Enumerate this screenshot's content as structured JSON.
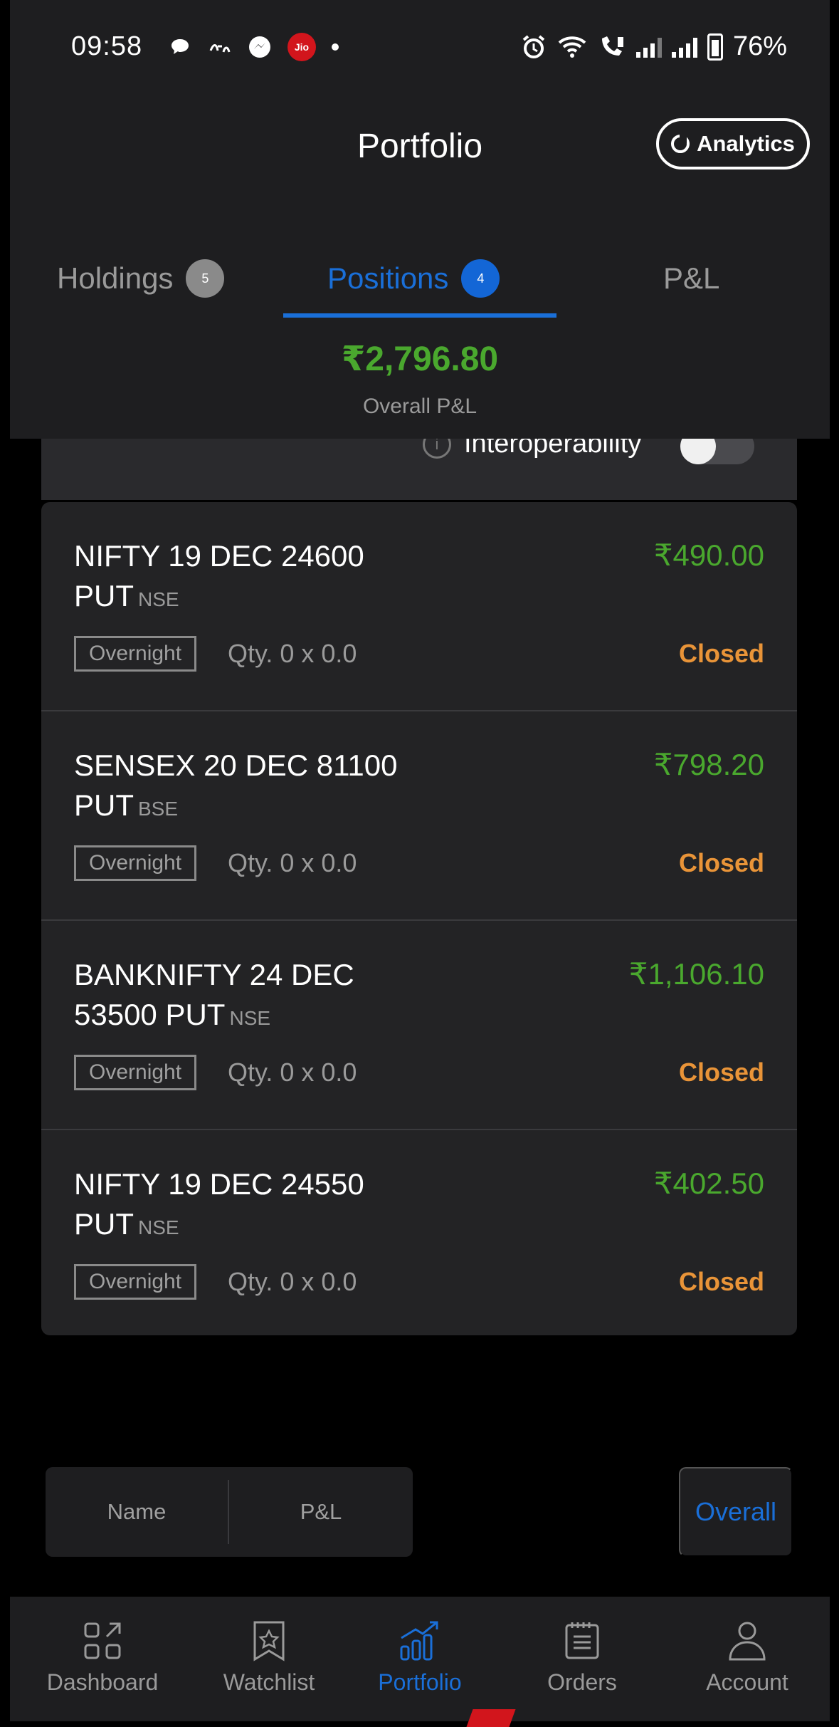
{
  "status_bar": {
    "time": "09:58",
    "battery": "76%",
    "carrier_badge": "Jio"
  },
  "header": {
    "title": "Portfolio",
    "analytics_label": "Analytics"
  },
  "tabs": [
    {
      "label": "Holdings",
      "badge": "5"
    },
    {
      "label": "Positions",
      "badge": "4"
    },
    {
      "label": "P&L"
    }
  ],
  "summary": {
    "overall_value": "₹2,796.80",
    "overall_label": "Overall P&L"
  },
  "interop": {
    "label": "Interoperability"
  },
  "positions": [
    {
      "name": "NIFTY 19 DEC 24600 PUT",
      "exchange": "NSE",
      "pnl": "₹490.00",
      "tag": "Overnight",
      "qty": "Qty. 0 x 0.0",
      "status": "Closed"
    },
    {
      "name": "SENSEX 20 DEC 81100 PUT",
      "exchange": "BSE",
      "pnl": "₹798.20",
      "tag": "Overnight",
      "qty": "Qty. 0 x 0.0",
      "status": "Closed"
    },
    {
      "name": "BANKNIFTY 24 DEC 53500 PUT",
      "exchange": "NSE",
      "pnl": "₹1,106.10",
      "tag": "Overnight",
      "qty": "Qty. 0 x 0.0",
      "status": "Closed"
    },
    {
      "name": "NIFTY 19 DEC 24550 PUT",
      "exchange": "NSE",
      "pnl": "₹402.50",
      "tag": "Overnight",
      "qty": "Qty. 0 x 0.0",
      "status": "Closed"
    }
  ],
  "sort": {
    "name_label": "Name",
    "pl_label": "P&L",
    "overall_label": "Overall"
  },
  "nav": [
    {
      "label": "Dashboard"
    },
    {
      "label": "Watchlist"
    },
    {
      "label": "Portfolio"
    },
    {
      "label": "Orders"
    },
    {
      "label": "Account"
    }
  ],
  "colors": {
    "accent": "#1a6fd8",
    "profit": "#4aa82e",
    "closed": "#e99438",
    "background": "#000000",
    "card": "#232325"
  }
}
